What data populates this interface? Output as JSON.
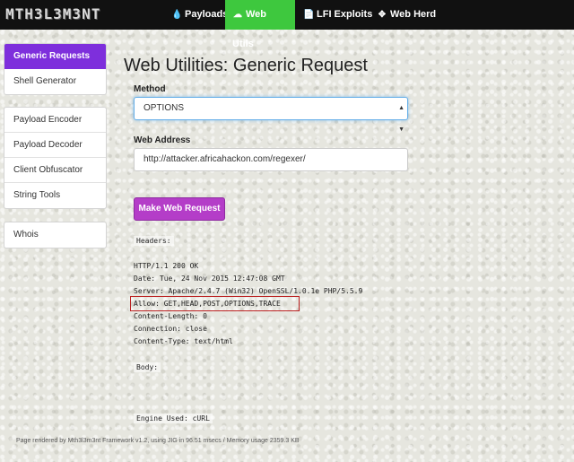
{
  "brand": "MTH3L3M3NT",
  "nav": [
    {
      "label": "Payloads",
      "icon": "droplet-icon",
      "glyph": "💧",
      "active": false
    },
    {
      "label": "Web Utils",
      "icon": "cloud-icon",
      "glyph": "☁",
      "active": true
    },
    {
      "label": "LFI Exploits",
      "icon": "file-icon",
      "glyph": "📄",
      "active": false
    },
    {
      "label": "Web Herd",
      "icon": "move-icon",
      "glyph": "✥",
      "active": false
    }
  ],
  "sidebar": {
    "group1": [
      "Generic Requests",
      "Shell Generator"
    ],
    "group2": [
      "Payload Encoder",
      "Payload Decoder",
      "Client Obfuscator",
      "String Tools"
    ],
    "group3": [
      "Whois"
    ]
  },
  "page_title": "Web Utilities: Generic Request",
  "form": {
    "method_label": "Method",
    "method_value": "OPTIONS",
    "address_label": "Web Address",
    "address_value": "http://attacker.africahackon.com/regexer/",
    "submit_label": "Make Web Request"
  },
  "response": {
    "headers_label": "Headers:",
    "lines": [
      "HTTP/1.1 200 OK",
      "Date: Tue, 24 Nov 2015 12:47:08 GMT",
      "Server: Apache/2.4.7 (Win32) OpenSSL/1.0.1e PHP/5.5.9",
      "Allow: GET,HEAD,POST,OPTIONS,TRACE",
      "Content-Length: 0",
      "Connection: close",
      "Content-Type: text/html"
    ],
    "body_label": "Body:",
    "engine_label": "Engine Used: cURL"
  },
  "footer": "Page rendered by Mth3l3m3nt Framework v1.2, using JIG in 96.51 msecs / Memory usage 2359.3 KB"
}
